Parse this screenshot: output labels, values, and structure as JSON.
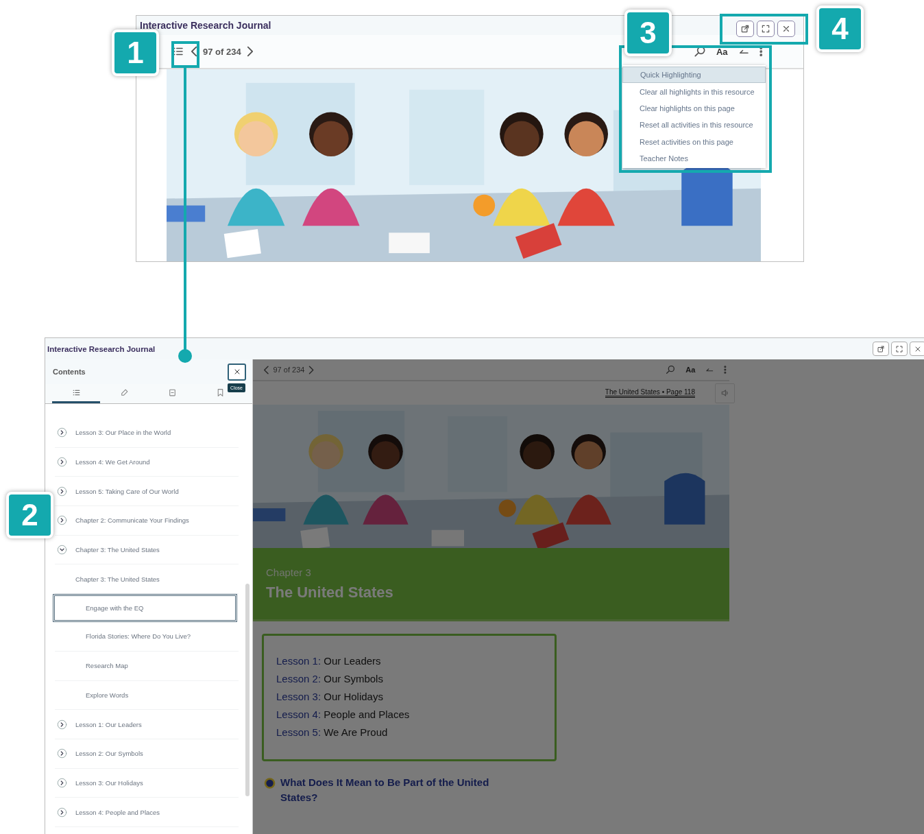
{
  "callouts": [
    {
      "label": "1"
    },
    {
      "label": "2"
    },
    {
      "label": "3"
    },
    {
      "label": "4"
    }
  ],
  "top_window": {
    "title": "Interactive Research Journal",
    "page_indicator": "97 of 234",
    "font_button": "Aa",
    "menu": [
      {
        "label": "Quick Highlighting",
        "selected": true
      },
      {
        "label": "Clear all highlights in this resource",
        "selected": false
      },
      {
        "label": "Clear highlights on this page",
        "selected": false
      },
      {
        "label": "Reset all activities in this resource",
        "selected": false
      },
      {
        "label": "Reset activities on this page",
        "selected": false
      },
      {
        "label": "Teacher Notes",
        "selected": false
      }
    ]
  },
  "bottom_window": {
    "title": "Interactive Research Journal",
    "sidebar": {
      "title": "Contents",
      "close_tooltip": "Close",
      "tabs": [
        {
          "selected": true
        },
        {
          "selected": false
        },
        {
          "selected": false
        },
        {
          "selected": false
        }
      ],
      "items": [
        {
          "label": "Lesson 3: Our Place in the World",
          "expanded": false
        },
        {
          "label": "Lesson 4: We Get Around",
          "expanded": false
        },
        {
          "label": "Lesson 5: Taking Care of Our World",
          "expanded": false
        },
        {
          "label": "Chapter 2: Communicate Your Findings",
          "expanded": false
        },
        {
          "label": "Chapter 3: The United States",
          "expanded": true,
          "children": [
            {
              "kind": "heading",
              "label": "Chapter 3: The United States",
              "selected": false
            },
            {
              "kind": "page",
              "label": "Engage with the EQ",
              "selected": true
            },
            {
              "kind": "page",
              "label": "Florida Stories: Where Do You Live?",
              "selected": false
            },
            {
              "kind": "page",
              "label": "Research Map",
              "selected": false
            },
            {
              "kind": "page",
              "label": "Explore Words",
              "selected": false
            }
          ]
        },
        {
          "label": "Lesson 1: Our Leaders",
          "expanded": false
        },
        {
          "label": "Lesson 2: Our Symbols",
          "expanded": false
        },
        {
          "label": "Lesson 3: Our Holidays",
          "expanded": false
        },
        {
          "label": "Lesson 4: People and Places",
          "expanded": false
        }
      ]
    },
    "reader": {
      "page_indicator": "97 of 234",
      "font_button": "Aa",
      "page_label": "The United States • Page 118",
      "chapter_label": "Chapter 3",
      "chapter_title": "The United States",
      "lessons": [
        {
          "number": "Lesson 1:",
          "title": "Our Leaders"
        },
        {
          "number": "Lesson 2:",
          "title": "Our Symbols"
        },
        {
          "number": "Lesson 3:",
          "title": "Our Holidays"
        },
        {
          "number": "Lesson 4:",
          "title": "People and Places"
        },
        {
          "number": "Lesson 5:",
          "title": "We Are Proud"
        }
      ],
      "question": "What Does It Mean to Be Part of the United States?"
    }
  }
}
